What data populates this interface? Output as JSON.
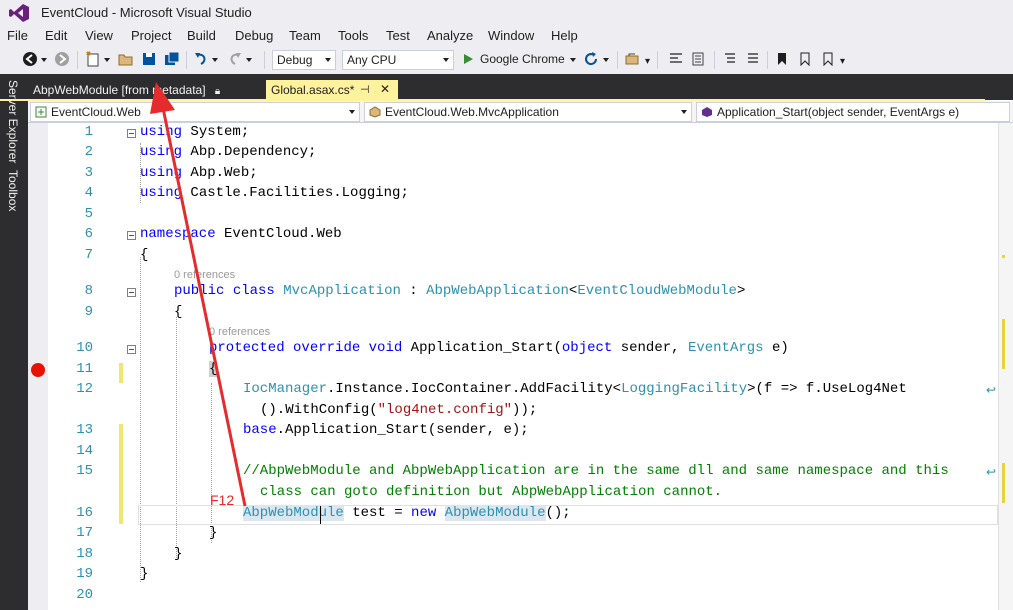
{
  "window": {
    "title": "EventCloud - Microsoft Visual Studio"
  },
  "menu": [
    "File",
    "Edit",
    "View",
    "Project",
    "Build",
    "Debug",
    "Team",
    "Tools",
    "Test",
    "Analyze",
    "Window",
    "Help"
  ],
  "toolbar": {
    "config": "Debug",
    "platform": "Any CPU",
    "run_target": "Google Chrome"
  },
  "sidebar": {
    "server_explorer": "Server Explorer",
    "toolbox": "Toolbox"
  },
  "tabs": {
    "metadata_tab": "AbpWebModule [from metadata]",
    "active_tab": "Global.asax.cs*"
  },
  "nav": {
    "project": "EventCloud.Web",
    "type": "EventCloud.Web.MvcApplication",
    "member": "Application_Start(object sender, EventArgs e)"
  },
  "code": {
    "line_numbers": [
      "1",
      "2",
      "3",
      "4",
      "5",
      "6",
      "7",
      "8",
      "9",
      "10",
      "11",
      "12",
      "13",
      "14",
      "15",
      "16",
      "17",
      "18",
      "19",
      "20"
    ],
    "l1_kw": "using",
    "l1_rest": " System;",
    "l2_kw": "using",
    "l2_rest": " Abp.Dependency;",
    "l3_kw": "using",
    "l3_rest": " Abp.Web;",
    "l4_kw": "using",
    "l4_rest": " Castle.Facilities.Logging;",
    "l6_kw": "namespace",
    "l6_rest": " EventCloud.Web",
    "l7": "{",
    "lens1": "0 references",
    "l8_kw1": "public",
    "l8_kw2": "class",
    "l8_ty1": "MvcApplication",
    "l8_colon": " : ",
    "l8_ty2": "AbpWebApplication",
    "l8_lt": "<",
    "l8_ty3": "EventCloudWebModule",
    "l8_gt": ">",
    "l9": "{",
    "lens2": "0 references",
    "l10_kw1": "protected",
    "l10_kw2": "override",
    "l10_kw3": "void",
    "l10_name": " Application_Start(",
    "l10_kw4": "object",
    "l10_mid": " sender, ",
    "l10_ty": "EventArgs",
    "l10_end": " e)",
    "l11": "{",
    "l12_ty1": "IocManager",
    "l12_mid": ".Instance.IocContainer.AddFacility<",
    "l12_ty2": "LoggingFacility",
    "l12_end": ">(f => f.UseLog4Net",
    "l12b_a": "().WithConfig(",
    "l12b_str": "\"log4net.config\"",
    "l12b_end": "));",
    "l13_kw": "base",
    "l13_rest": ".Application_Start(sender, e);",
    "l15_comment": "//AbpWebModule and AbpWebApplication are in the same dll and same namespace and this",
    "l15b_comment": "class can goto definition but AbpWebApplication cannot.",
    "l16_ty1": "AbpWebModule",
    "l16_mid": " test = ",
    "l16_kw": "new",
    "l16_ty2": "AbpWebModule",
    "l16_end": "();",
    "l17": "}",
    "l18": "}",
    "l19": "}"
  },
  "annotation": {
    "label": "F12",
    "color": "#e52b2b"
  }
}
